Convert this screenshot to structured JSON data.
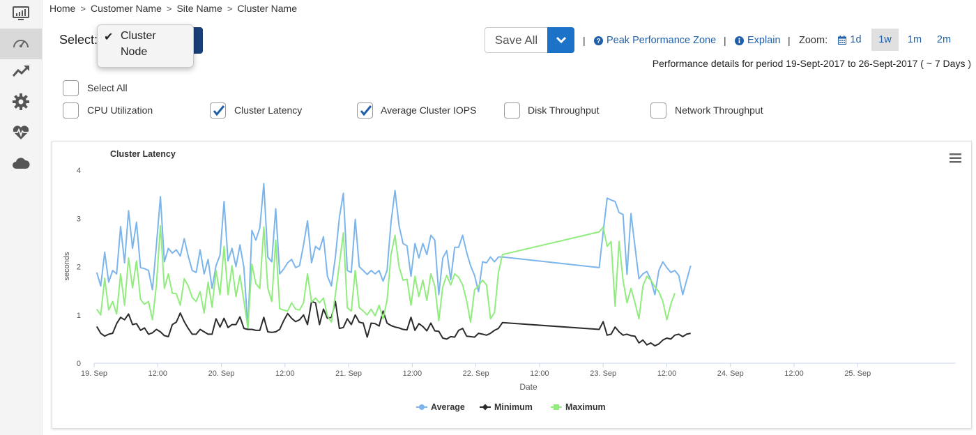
{
  "breadcrumb": {
    "items": [
      "Home",
      "Customer Name",
      "Site Name",
      "Cluster Name"
    ],
    "separator": ">"
  },
  "selector": {
    "label": "Select:",
    "options": [
      {
        "label": "Cluster",
        "checked": true
      },
      {
        "label": "Node",
        "checked": false
      }
    ]
  },
  "toolbar": {
    "save_label": "Save All",
    "divider": "|",
    "peak_label": "Peak Performance Zone",
    "explain_label": "Explain",
    "zoom_label": "Zoom:",
    "zoom_options": [
      {
        "label": "1d",
        "active": false
      },
      {
        "label": "1w",
        "active": true
      },
      {
        "label": "1m",
        "active": false
      },
      {
        "label": "2m",
        "active": false
      }
    ]
  },
  "period_text": "Performance details for period 19-Sept-2017 to 26-Sept-2017 ( ~ 7 Days )",
  "metrics": {
    "select_all": {
      "label": "Select All",
      "checked": false
    },
    "items": [
      {
        "label": "CPU Utilization",
        "checked": false
      },
      {
        "label": "Cluster Latency",
        "checked": true
      },
      {
        "label": "Average Cluster IOPS",
        "checked": true
      },
      {
        "label": "Disk Throughput",
        "checked": false
      },
      {
        "label": "Network Throughput",
        "checked": false
      }
    ]
  },
  "colors": {
    "accent": "#1b72c7",
    "select_button": "#1a3e78",
    "link": "#1f5ea8",
    "average": "#7cb5ec",
    "minimum": "#2b2b2b",
    "maximum": "#90ed7d"
  },
  "sidebar_icons": [
    "monitor-icon",
    "speedometer-icon",
    "trend-up-icon",
    "gear-icon",
    "heart-pulse-icon",
    "cloud-icon"
  ],
  "chart_data": {
    "type": "line",
    "title": "Cluster Latency",
    "xlabel": "Date",
    "ylabel": "seconds",
    "ylim": [
      0,
      4
    ],
    "yticks": [
      0,
      1,
      2,
      3,
      4
    ],
    "xlim": [
      "2017-09-19 00:00",
      "2017-09-25 18:30"
    ],
    "xticks": [
      {
        "t": "2017-09-19 00:00",
        "label": "19. Sep"
      },
      {
        "t": "2017-09-19 12:00",
        "label": "12:00"
      },
      {
        "t": "2017-09-20 00:00",
        "label": "20. Sep"
      },
      {
        "t": "2017-09-20 12:00",
        "label": "12:00"
      },
      {
        "t": "2017-09-21 00:00",
        "label": "21. Sep"
      },
      {
        "t": "2017-09-21 12:00",
        "label": "12:00"
      },
      {
        "t": "2017-09-22 00:00",
        "label": "22. Sep"
      },
      {
        "t": "2017-09-22 12:00",
        "label": "12:00"
      },
      {
        "t": "2017-09-23 00:00",
        "label": "23. Sep"
      },
      {
        "t": "2017-09-23 12:00",
        "label": "12:00"
      },
      {
        "t": "2017-09-24 00:00",
        "label": "24. Sep"
      },
      {
        "t": "2017-09-24 12:00",
        "label": "12:00"
      },
      {
        "t": "2017-09-25 00:00",
        "label": "25. Sep"
      }
    ],
    "x": [
      "2017-09-19 00:30",
      "2017-09-19 01:15",
      "2017-09-19 02:00",
      "2017-09-19 02:45",
      "2017-09-19 03:30",
      "2017-09-19 04:15",
      "2017-09-19 05:00",
      "2017-09-19 05:45",
      "2017-09-19 06:30",
      "2017-09-19 07:15",
      "2017-09-19 08:00",
      "2017-09-19 08:45",
      "2017-09-19 09:30",
      "2017-09-19 10:15",
      "2017-09-19 11:00",
      "2017-09-19 11:45",
      "2017-09-19 12:30",
      "2017-09-19 13:15",
      "2017-09-19 14:00",
      "2017-09-19 14:45",
      "2017-09-19 15:30",
      "2017-09-19 16:15",
      "2017-09-19 17:00",
      "2017-09-19 17:45",
      "2017-09-19 18:30",
      "2017-09-19 19:15",
      "2017-09-19 20:00",
      "2017-09-19 20:45",
      "2017-09-19 21:30",
      "2017-09-19 22:15",
      "2017-09-19 23:00",
      "2017-09-19 23:45",
      "2017-09-20 00:30",
      "2017-09-20 01:15",
      "2017-09-20 02:00",
      "2017-09-20 02:45",
      "2017-09-20 03:30",
      "2017-09-20 04:15",
      "2017-09-20 05:00",
      "2017-09-20 05:45",
      "2017-09-20 06:30",
      "2017-09-20 07:15",
      "2017-09-20 08:00",
      "2017-09-20 08:45",
      "2017-09-20 09:30",
      "2017-09-20 10:15",
      "2017-09-20 11:00",
      "2017-09-20 11:45",
      "2017-09-20 12:30",
      "2017-09-20 13:15",
      "2017-09-20 14:00",
      "2017-09-20 14:45",
      "2017-09-20 15:30",
      "2017-09-20 16:15",
      "2017-09-20 17:00",
      "2017-09-20 17:45",
      "2017-09-20 18:30",
      "2017-09-20 19:15",
      "2017-09-20 20:00",
      "2017-09-20 20:45",
      "2017-09-20 21:30",
      "2017-09-20 22:15",
      "2017-09-20 23:00",
      "2017-09-20 23:45",
      "2017-09-21 00:30",
      "2017-09-21 01:15",
      "2017-09-21 02:00",
      "2017-09-21 02:45",
      "2017-09-21 03:30",
      "2017-09-21 04:15",
      "2017-09-21 05:00",
      "2017-09-21 05:45",
      "2017-09-21 06:30",
      "2017-09-21 07:15",
      "2017-09-21 08:00",
      "2017-09-21 08:45",
      "2017-09-21 09:30",
      "2017-09-21 10:15",
      "2017-09-21 11:00",
      "2017-09-21 11:45",
      "2017-09-21 12:30",
      "2017-09-21 13:15",
      "2017-09-21 14:00",
      "2017-09-21 14:45",
      "2017-09-21 15:30",
      "2017-09-21 16:15",
      "2017-09-21 17:00",
      "2017-09-21 17:45",
      "2017-09-21 18:30",
      "2017-09-21 19:15",
      "2017-09-21 20:00",
      "2017-09-21 20:45",
      "2017-09-21 21:30",
      "2017-09-21 22:15",
      "2017-09-21 23:00",
      "2017-09-21 23:45",
      "2017-09-22 00:30",
      "2017-09-22 01:15",
      "2017-09-22 02:00",
      "2017-09-22 02:45",
      "2017-09-22 03:30",
      "2017-09-22 04:15",
      "2017-09-22 05:00",
      "2017-09-22 23:15",
      "2017-09-23 00:00",
      "2017-09-23 00:45",
      "2017-09-23 01:30",
      "2017-09-23 02:15",
      "2017-09-23 03:00",
      "2017-09-23 03:45",
      "2017-09-23 04:30",
      "2017-09-23 05:15",
      "2017-09-23 06:00",
      "2017-09-23 06:45",
      "2017-09-23 07:30",
      "2017-09-23 08:15",
      "2017-09-23 09:00",
      "2017-09-23 09:45",
      "2017-09-23 10:30",
      "2017-09-23 11:15",
      "2017-09-23 12:00",
      "2017-09-23 12:45",
      "2017-09-23 13:30",
      "2017-09-23 14:15",
      "2017-09-23 15:00",
      "2017-09-23 15:45",
      "2017-09-23 16:30",
      "2017-09-23 17:15",
      "2017-09-23 18:00",
      "2017-09-23 18:45",
      "2017-09-23 19:30",
      "2017-09-23 20:15",
      "2017-09-23 21:00",
      "2017-09-23 21:45",
      "2017-09-23 22:30",
      "2017-09-23 23:15",
      "2017-09-24 00:00",
      "2017-09-24 00:45",
      "2017-09-24 01:30",
      "2017-09-24 02:15",
      "2017-09-24 03:00",
      "2017-09-24 03:45",
      "2017-09-24 04:30",
      "2017-09-24 05:15",
      "2017-09-24 06:00",
      "2017-09-24 06:45",
      "2017-09-24 07:30",
      "2017-09-24 08:15",
      "2017-09-24 09:00",
      "2017-09-24 09:45",
      "2017-09-24 10:30",
      "2017-09-24 11:15",
      "2017-09-24 12:00",
      "2017-09-24 12:45",
      "2017-09-24 13:30",
      "2017-09-24 14:15",
      "2017-09-24 15:00",
      "2017-09-24 15:45",
      "2017-09-24 16:30",
      "2017-09-24 17:15",
      "2017-09-24 18:00"
    ],
    "series": [
      {
        "name": "Average",
        "color": "#7cb5ec",
        "marker": "circle",
        "values": [
          1.88,
          1.6,
          2.3,
          1.68,
          1.92,
          1.85,
          2.83,
          2.08,
          3.16,
          2.38,
          2.92,
          1.98,
          1.96,
          1.92,
          1.52,
          2.45,
          3.45,
          2.1,
          2.38,
          2.28,
          2.35,
          2.22,
          2.58,
          2.22,
          1.92,
          1.88,
          2.35,
          1.85,
          2.15,
          1.55,
          2.02,
          2.24,
          3.35,
          2.12,
          2.38,
          2.0,
          2.45,
          1.98,
          0.72,
          2.75,
          2.55,
          2.8,
          3.72,
          2.2,
          2.1,
          3.2,
          1.85,
          1.95,
          2.08,
          2.15,
          1.98,
          2.02,
          2.45,
          2.95,
          2.08,
          2.42,
          2.35,
          2.62,
          1.8,
          1.6,
          2.2,
          3.02,
          3.52,
          1.92,
          1.88,
          2.98,
          2.0,
          1.92,
          1.84,
          1.92,
          1.85,
          1.92,
          1.7,
          1.92,
          2.92,
          3.58,
          2.85,
          2.48,
          2.43,
          1.8,
          2.48,
          2.18,
          2.48,
          2.25,
          2.65,
          2.55,
          1.42,
          2.18,
          2.33,
          1.73,
          2.4,
          2.4,
          2.65,
          2.3,
          2.02,
          1.82,
          1.48,
          2.1,
          2.08,
          2.2,
          2.1,
          2.2,
          2.2,
          1.98,
          2.72,
          3.42,
          3.38,
          3.35,
          3.12,
          3.08,
          1.84,
          3.1,
          2.42,
          1.75,
          1.85,
          1.9,
          1.73,
          1.42,
          1.92,
          2.1,
          1.98,
          1.88,
          1.92,
          1.82,
          1.42,
          1.72,
          2.02
        ]
      },
      {
        "name": "Minimum",
        "color": "#2b2b2b",
        "marker": "diamond",
        "values": [
          0.76,
          0.62,
          0.56,
          0.6,
          0.62,
          0.82,
          0.95,
          0.9,
          1.02,
          0.8,
          0.82,
          0.68,
          0.73,
          0.6,
          0.63,
          0.7,
          0.65,
          0.57,
          0.55,
          0.8,
          0.85,
          1.04,
          0.86,
          0.72,
          0.6,
          0.6,
          0.7,
          0.65,
          0.6,
          0.6,
          0.92,
          0.75,
          0.93,
          0.74,
          0.8,
          0.8,
          0.96,
          0.72,
          0.7,
          0.7,
          0.68,
          0.68,
          0.95,
          0.65,
          0.64,
          0.65,
          0.7,
          0.88,
          1.03,
          0.93,
          0.86,
          0.9,
          1.0,
          0.8,
          1.28,
          1.25,
          0.8,
          1.12,
          0.93,
          0.95,
          1.28,
          0.72,
          0.74,
          0.92,
          0.8,
          1.0,
          0.85,
          0.83,
          0.54,
          0.83,
          0.82,
          0.77,
          1.08,
          0.83,
          0.78,
          0.75,
          0.73,
          0.7,
          0.69,
          0.95,
          0.68,
          0.82,
          0.76,
          0.67,
          0.83,
          0.67,
          0.66,
          0.52,
          0.5,
          0.55,
          0.54,
          0.68,
          0.72,
          0.56,
          0.55,
          0.54,
          0.62,
          0.6,
          0.58,
          0.62,
          0.68,
          0.72,
          0.84,
          0.7,
          0.86,
          0.58,
          0.6,
          0.75,
          0.65,
          0.58,
          0.6,
          0.57,
          0.56,
          0.42,
          0.48,
          0.38,
          0.42,
          0.36,
          0.4,
          0.48,
          0.52,
          0.5,
          0.58,
          0.6,
          0.55,
          0.6,
          0.62
        ]
      },
      {
        "name": "Maximum",
        "color": "#90ed7d",
        "marker": "square",
        "values": [
          1.12,
          1.0,
          1.76,
          1.1,
          1.28,
          1.02,
          1.85,
          1.2,
          2.18,
          1.56,
          2.12,
          1.32,
          1.22,
          1.28,
          0.9,
          1.62,
          2.85,
          1.55,
          1.85,
          1.45,
          1.44,
          1.2,
          1.75,
          1.6,
          1.36,
          1.28,
          1.48,
          1.04,
          1.68,
          1.16,
          1.92,
          1.42,
          2.42,
          1.42,
          2.02,
          1.38,
          1.82,
          1.28,
          0.73,
          2.05,
          1.65,
          1.55,
          2.82,
          1.56,
          1.28,
          2.55,
          1.13,
          1.1,
          1.08,
          1.25,
          1.12,
          1.1,
          1.25,
          1.85,
          1.27,
          1.35,
          1.25,
          1.35,
          0.98,
          0.85,
          1.42,
          2.05,
          2.7,
          1.15,
          1.08,
          1.92,
          1.15,
          1.08,
          1.0,
          1.12,
          0.98,
          1.2,
          0.92,
          1.3,
          2.25,
          2.65,
          2.0,
          1.72,
          1.74,
          1.2,
          1.8,
          1.38,
          1.72,
          1.3,
          1.85,
          1.6,
          0.88,
          1.58,
          1.82,
          1.62,
          1.85,
          1.78,
          1.62,
          1.3,
          0.85,
          1.52,
          1.6,
          1.72,
          1.62,
          0.92,
          1.05,
          1.88,
          2.25,
          2.72,
          2.82,
          2.42,
          2.52,
          1.18,
          2.52,
          1.72,
          1.25,
          1.55,
          1.25,
          0.92,
          1.6,
          1.8,
          1.72,
          1.58,
          1.48,
          1.28,
          0.9,
          1.22,
          1.45
        ]
      }
    ]
  }
}
